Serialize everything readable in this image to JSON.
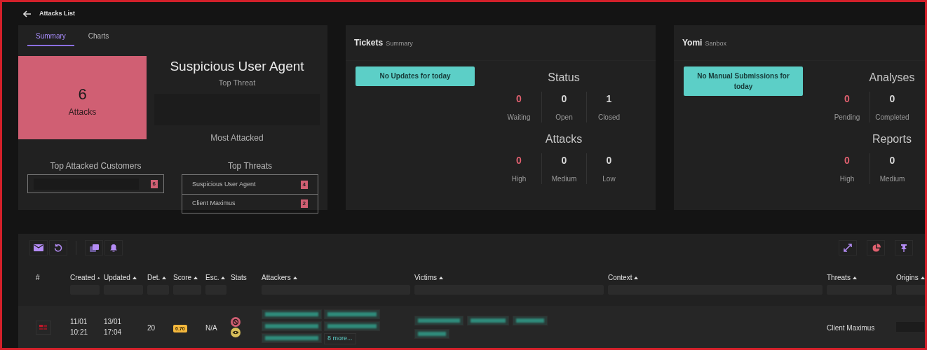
{
  "back_link": {
    "label": "Attacks List"
  },
  "summary": {
    "tabs": [
      {
        "label": "Summary",
        "selected": true
      },
      {
        "label": "Charts",
        "selected": false
      }
    ],
    "attacks_count": "6",
    "attacks_label": "Attacks",
    "top_threat": "Suspicious User Agent",
    "top_threat_label": "Top Threat",
    "most_attacked_label": "Most Attacked",
    "top_customers": {
      "title": "Top Attacked Customers",
      "items": [
        {
          "count": "6"
        }
      ]
    },
    "top_threats": {
      "title": "Top Threats",
      "items": [
        {
          "name": "Suspicious User Agent",
          "count": "4"
        },
        {
          "name": "Client Maximus",
          "count": "2"
        }
      ]
    }
  },
  "tickets": {
    "title": "Tickets",
    "subtitle": "Summary",
    "notice": "No Updates for today",
    "groups": [
      {
        "title": "Status",
        "stats": [
          {
            "value": "0",
            "label": "Waiting",
            "highlight": true
          },
          {
            "value": "0",
            "label": "Open",
            "highlight": false
          },
          {
            "value": "1",
            "label": "Closed",
            "highlight": false
          }
        ]
      },
      {
        "title": "Attacks",
        "stats": [
          {
            "value": "0",
            "label": "High",
            "highlight": true
          },
          {
            "value": "0",
            "label": "Medium",
            "highlight": false
          },
          {
            "value": "0",
            "label": "Low",
            "highlight": false
          }
        ]
      }
    ]
  },
  "sandbox": {
    "title": "Yomi",
    "subtitle": "Sanbox",
    "notice": "No Manual Submissions for today",
    "groups": [
      {
        "title": "Analyses",
        "stats": [
          {
            "value": "0",
            "label": "Pending",
            "highlight": true
          },
          {
            "value": "0",
            "label": "Completed",
            "highlight": false
          }
        ]
      },
      {
        "title": "Reports",
        "stats": [
          {
            "value": "0",
            "label": "High",
            "highlight": true
          },
          {
            "value": "0",
            "label": "Medium",
            "highlight": false
          }
        ]
      }
    ]
  },
  "table": {
    "columns": [
      {
        "label": "#",
        "sortable": false
      },
      {
        "label": "Created",
        "sortable": true
      },
      {
        "label": "Updated",
        "sortable": true
      },
      {
        "label": "Det.",
        "sortable": true
      },
      {
        "label": "Score",
        "sortable": true
      },
      {
        "label": "Esc.",
        "sortable": true
      },
      {
        "label": "Stats",
        "sortable": false
      },
      {
        "label": "Attackers",
        "sortable": true
      },
      {
        "label": "Victims",
        "sortable": true
      },
      {
        "label": "Context",
        "sortable": true
      },
      {
        "label": "Threats",
        "sortable": true
      },
      {
        "label": "Origins",
        "sortable": true
      }
    ],
    "rows": [
      {
        "created_date": "11/01",
        "created_time": "10:21",
        "updated_date": "13/01",
        "updated_time": "17:04",
        "detections": "20",
        "score": "0.70",
        "escalation": "N/A",
        "attackers_more": "8 more...",
        "threats": "Client Maximus"
      }
    ]
  }
}
